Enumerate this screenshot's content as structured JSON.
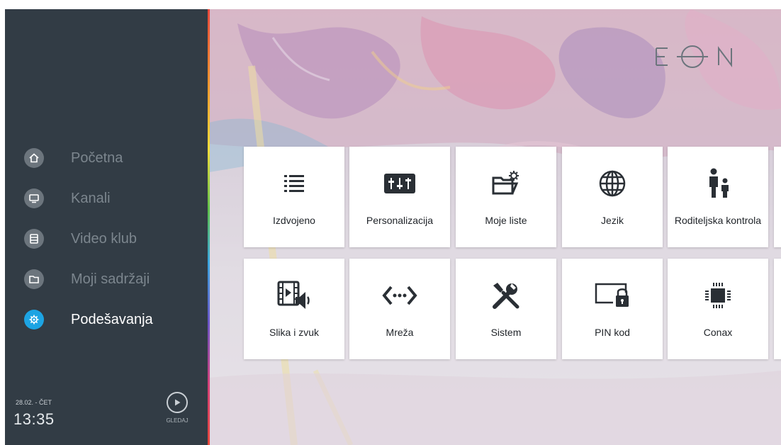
{
  "nav": {
    "items": [
      {
        "label": "Početna",
        "icon": "home-icon"
      },
      {
        "label": "Kanali",
        "icon": "tv-icon"
      },
      {
        "label": "Video klub",
        "icon": "film-icon"
      },
      {
        "label": "Moji sadržaji",
        "icon": "folder-icon"
      },
      {
        "label": "Podešavanja",
        "icon": "gear-icon",
        "active": true
      }
    ]
  },
  "footer": {
    "date": "28.02. - ČET",
    "time": "13:35",
    "watch_label": "GLEDAJ"
  },
  "logo": {
    "text": "EON"
  },
  "settings": {
    "tiles": [
      {
        "label": "Izdvojeno",
        "icon": "list-icon"
      },
      {
        "label": "Personalizacija",
        "icon": "equalizer-icon"
      },
      {
        "label": "Moje liste",
        "icon": "folder-settings-icon"
      },
      {
        "label": "Jezik",
        "icon": "globe-icon"
      },
      {
        "label": "Roditeljska kontrola",
        "icon": "parent-child-icon"
      },
      {
        "label": "Slika i zvuk",
        "icon": "video-sound-icon"
      },
      {
        "label": "Mreža",
        "icon": "network-arrows-icon"
      },
      {
        "label": "Sistem",
        "icon": "tools-icon"
      },
      {
        "label": "PIN kod",
        "icon": "screen-lock-icon"
      },
      {
        "label": "Conax",
        "icon": "chip-icon"
      }
    ]
  },
  "colors": {
    "sidebar_bg": "#323c45",
    "accent": "#1da4e3",
    "inactive_text": "#7c868e",
    "tile_bg": "#ffffff",
    "icon_dark": "#2a2f35"
  }
}
